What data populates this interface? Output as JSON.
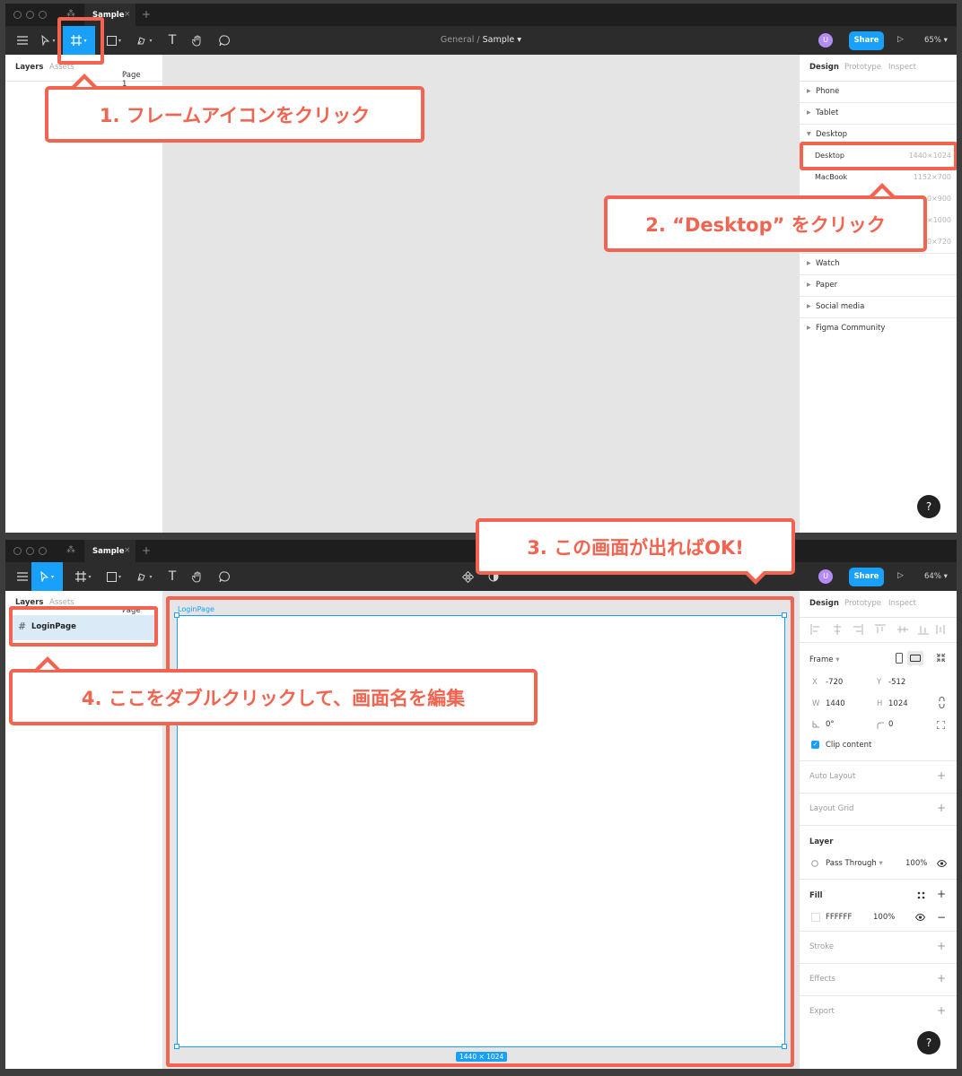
{
  "app": {
    "tab_name": "Sample",
    "tab_close": "×",
    "new_tab": "+",
    "breadcrumb_team": "General",
    "breadcrumb_sep": "/",
    "breadcrumb_file": "Sample",
    "avatar_letter": "U",
    "share_label": "Share",
    "play_icon": "play-icon"
  },
  "shot1": {
    "zoom": "65%",
    "left_tabs": [
      "Layers",
      "Assets"
    ],
    "page": "Page 1",
    "right_tabs": [
      "Design",
      "Prototype",
      "Inspect"
    ],
    "groups_top": [
      "Phone",
      "Tablet",
      "Desktop"
    ],
    "presets": [
      {
        "name": "Desktop",
        "size": "1440×1024"
      },
      {
        "name": "MacBook",
        "size": "1152×700"
      },
      {
        "name": "",
        "size": "0×900"
      },
      {
        "name": "",
        "size": "×1000"
      },
      {
        "name": "",
        "size": "0×720"
      }
    ],
    "groups_bottom": [
      "Watch",
      "Paper",
      "Social media",
      "Figma Community"
    ],
    "help": "?"
  },
  "shot2": {
    "zoom": "64%",
    "left_tabs": [
      "Layers",
      "Assets"
    ],
    "page": "Page 1",
    "layer_name": "LoginPage",
    "frame_label": "LoginPage",
    "frame_size": "1440 × 1024",
    "right_tabs": [
      "Design",
      "Prototype",
      "Inspect"
    ],
    "frame_section": "Frame",
    "x_label": "X",
    "x_value": "-720",
    "y_label": "Y",
    "y_value": "-512",
    "w_label": "W",
    "w_value": "1440",
    "h_label": "H",
    "h_value": "1024",
    "rotation": "0°",
    "radius": "0",
    "clip_content": "Clip content",
    "auto_layout": "Auto Layout",
    "layout_grid": "Layout Grid",
    "layer_section": "Layer",
    "blend_mode": "Pass Through",
    "layer_opacity": "100%",
    "fill_section": "Fill",
    "fill_hex": "FFFFFF",
    "fill_opacity": "100%",
    "stroke": "Stroke",
    "effects": "Effects",
    "export": "Export",
    "help": "?"
  },
  "callouts": {
    "c1": "1. フレームアイコンをクリック",
    "c2": "2. “Desktop” をクリック",
    "c3": "3. この画面が出ればOK!",
    "c4": "4. ここをダブルクリックして、画面名を編集"
  },
  "colors": {
    "accent": "#18a0fb",
    "annotation": "#f26450",
    "toolbar": "#2c2c2c"
  }
}
